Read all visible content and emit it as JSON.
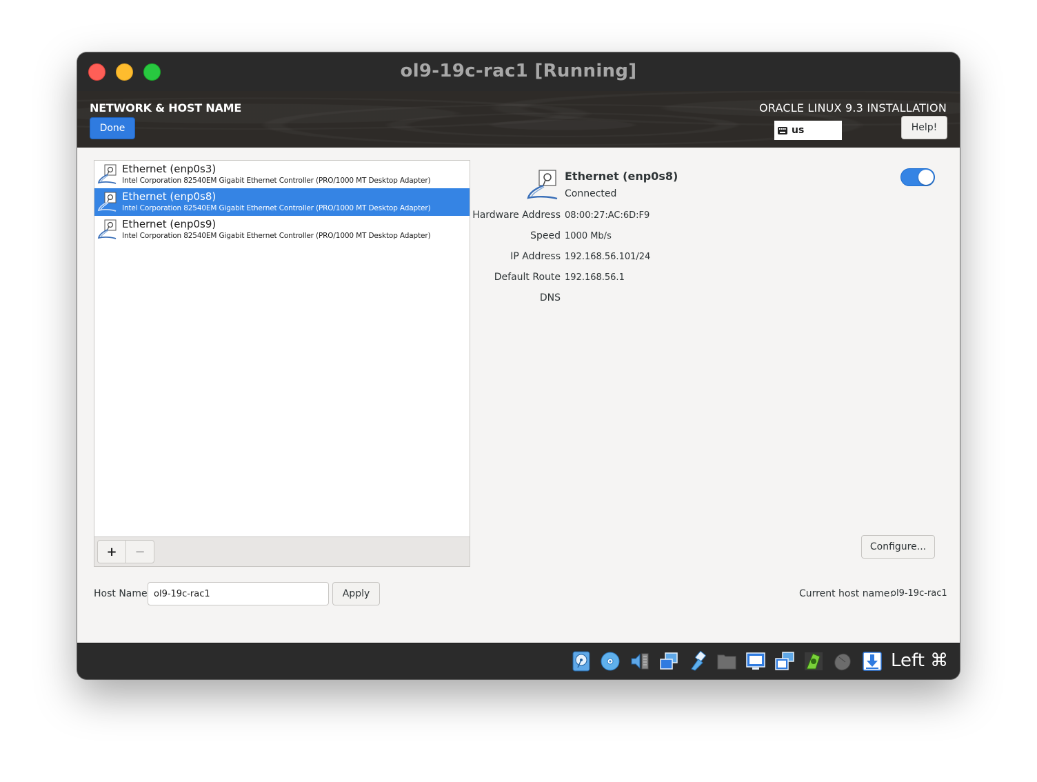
{
  "window": {
    "title": "ol9-19c-rac1 [Running]"
  },
  "header": {
    "spoke_title": "NETWORK & HOST NAME",
    "done_label": "Done",
    "product_title": "ORACLE LINUX 9.3 INSTALLATION",
    "keyboard_layout": "us",
    "help_label": "Help!"
  },
  "devices": [
    {
      "name": "Ethernet (enp0s3)",
      "description": "Intel Corporation 82540EM Gigabit Ethernet Controller (PRO/1000 MT Desktop Adapter)",
      "selected": false
    },
    {
      "name": "Ethernet (enp0s8)",
      "description": "Intel Corporation 82540EM Gigabit Ethernet Controller (PRO/1000 MT Desktop Adapter)",
      "selected": true
    },
    {
      "name": "Ethernet (enp0s9)",
      "description": "Intel Corporation 82540EM Gigabit Ethernet Controller (PRO/1000 MT Desktop Adapter)",
      "selected": false
    }
  ],
  "list_toolbar": {
    "add_label": "+",
    "remove_label": "−"
  },
  "detail": {
    "name": "Ethernet (enp0s8)",
    "status": "Connected",
    "enabled": true,
    "properties": [
      {
        "label": "Hardware Address",
        "value": "08:00:27:AC:6D:F9"
      },
      {
        "label": "Speed",
        "value": "1000 Mb/s"
      },
      {
        "label": "IP Address",
        "value": "192.168.56.101/24"
      },
      {
        "label": "Default Route",
        "value": "192.168.56.1"
      },
      {
        "label": "DNS",
        "value": ""
      }
    ],
    "configure_label": "Configure..."
  },
  "hostname": {
    "label": "Host Name:",
    "value": "ol9-19c-rac1",
    "apply_label": "Apply",
    "current_label": "Current host name:",
    "current_value": "ol9-19c-rac1"
  },
  "statusbar": {
    "host_key": "Left ⌘",
    "icons": [
      "hard-disk-icon",
      "optical-drive-icon",
      "audio-icon",
      "network-icon",
      "usb-icon",
      "shared-folders-icon",
      "display-icon",
      "screen-capture-icon",
      "guest-additions-icon",
      "mouse-integration-icon",
      "download-arrow-icon"
    ]
  },
  "colors": {
    "accent": "#3584e4",
    "done_button": "#2f7be0",
    "titlebar": "#2a2a2a",
    "header_bg": "#2e2b28",
    "content_bg": "#f5f4f3"
  }
}
